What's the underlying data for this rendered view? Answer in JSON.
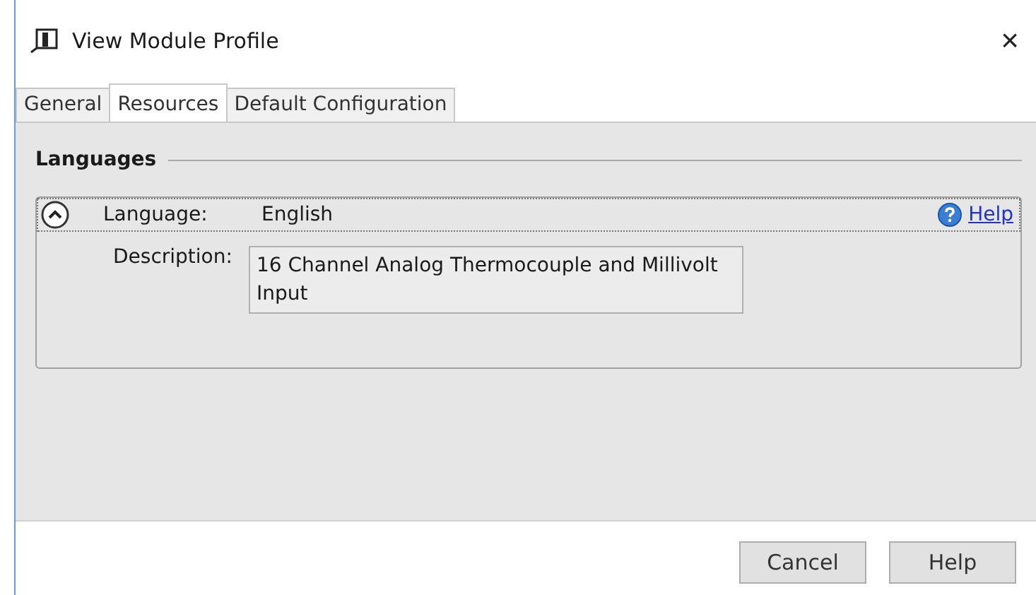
{
  "window": {
    "title": "View Module Profile",
    "close": "×"
  },
  "tabs": [
    {
      "label": "General",
      "selected": false
    },
    {
      "label": "Resources",
      "selected": true
    },
    {
      "label": "Default Configuration",
      "selected": false
    }
  ],
  "group": {
    "title": "Languages"
  },
  "section": {
    "expanded": true,
    "language_label": "Language:",
    "language": "English",
    "help_link": "Help",
    "description_label": "Description:",
    "description": "16 Channel Analog Thermocouple and Millivolt Input"
  },
  "buttons": [
    {
      "label": "Cancel"
    },
    {
      "label": "Help"
    }
  ]
}
